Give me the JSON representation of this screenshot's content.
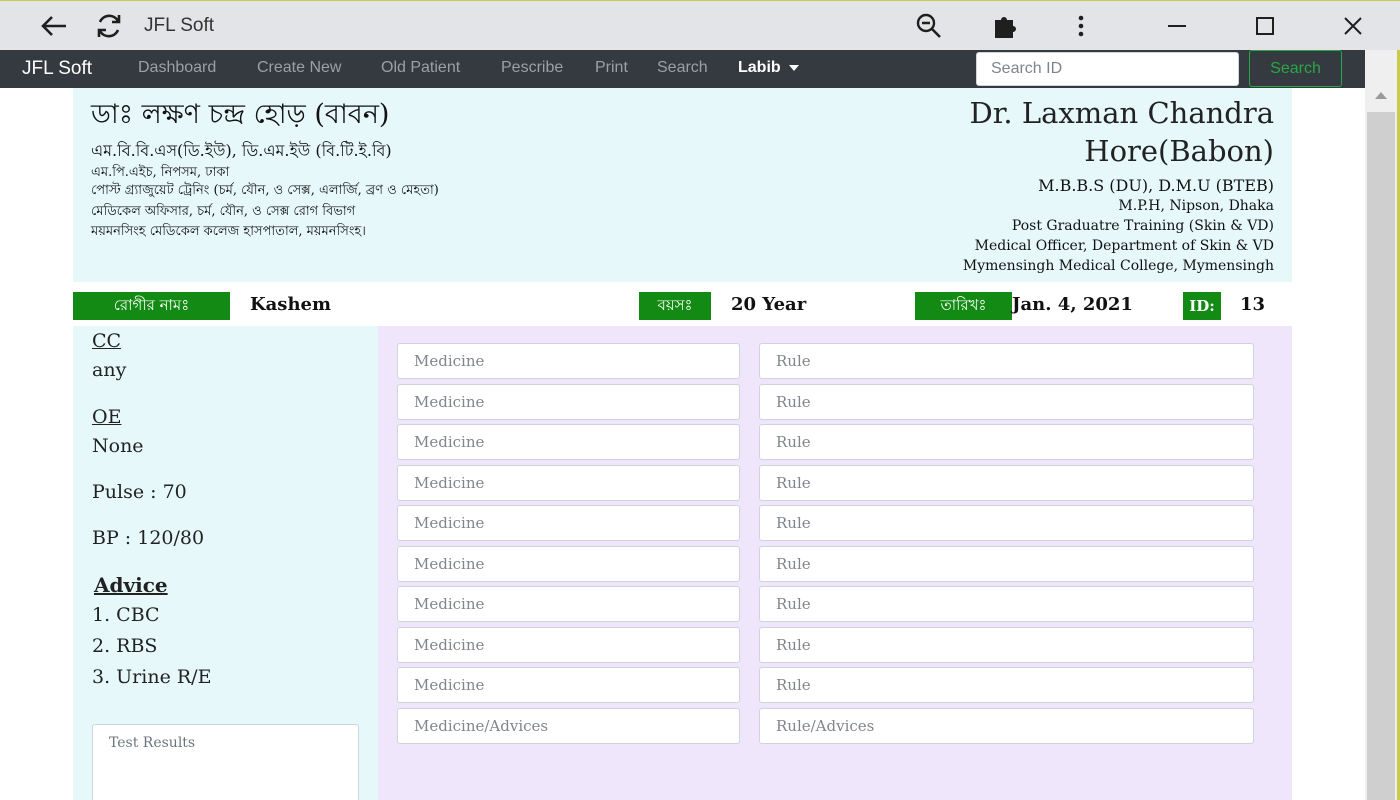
{
  "window": {
    "title": "JFL Soft",
    "icons": [
      "back-arrow-icon",
      "reload-icon",
      "zoom-out-icon",
      "extensions-icon",
      "more-vert-icon",
      "minimize-icon",
      "maximize-icon",
      "close-icon"
    ]
  },
  "navbar": {
    "brand": "JFL Soft",
    "links": [
      "Dashboard",
      "Create New",
      "Old Patient",
      "Pescribe",
      "Print",
      "Search"
    ],
    "user": "Labib",
    "search_placeholder": "Search ID",
    "search_button": "Search"
  },
  "doctor": {
    "bn_name": "ডাঃ লক্ষণ চন্দ্র হোড় (বাবন)",
    "bn_degrees": "এম.বি.বি.এস(ডি.ইউ), ডি.এম.ইউ (বি.টি.ই.বি)",
    "bn_lines": [
      "এম.পি.এইচ, নিপসম, ঢাকা",
      "পোস্ট গ্র্যাজুয়েট ট্রেনিং (চর্ম, যৌন, ও সেক্স, এলার্জি, ব্রণ ও মেহতা)",
      "মেডিকেল অফিসার, চর্ম, যৌন, ও সেক্স রোগ বিভাগ",
      "ময়মনসিংহ মেডিকেল কলেজ হাসপাতাল, ময়মনসিংহ।"
    ],
    "en_name": "Dr. Laxman Chandra Hore(Babon)",
    "en_degrees": "M.B.B.S (DU), D.M.U (BTEB)",
    "en_lines": [
      "M.P.H, Nipson, Dhaka",
      "Post Graduatre Training (Skin & VD)",
      "Medical Officer, Department of Skin & VD",
      "Mymensingh Medical College, Mymensingh"
    ]
  },
  "patient": {
    "name_label": "রোগীর নামঃ",
    "name": "Kashem",
    "age_label": "বয়সঃ",
    "age": "20 Year",
    "date_label": "তারিখঃ",
    "date": "Jan. 4, 2021",
    "id_label": "ID:",
    "id": "13"
  },
  "findings": {
    "cc_label": "CC",
    "cc_value": "any",
    "oe_label": "OE",
    "oe_value": "None",
    "pulse": "Pulse : 70",
    "bp": "BP : 120/80",
    "advice_label": "Advice",
    "advice_items": [
      "1. CBC",
      "2. RBS",
      "3. Urine R/E"
    ],
    "test_results_placeholder": "Test Results"
  },
  "prescription": {
    "rows": [
      {
        "medicine": "Medicine",
        "rule": "Rule"
      },
      {
        "medicine": "Medicine",
        "rule": "Rule"
      },
      {
        "medicine": "Medicine",
        "rule": "Rule"
      },
      {
        "medicine": "Medicine",
        "rule": "Rule"
      },
      {
        "medicine": "Medicine",
        "rule": "Rule"
      },
      {
        "medicine": "Medicine",
        "rule": "Rule"
      },
      {
        "medicine": "Medicine",
        "rule": "Rule"
      },
      {
        "medicine": "Medicine",
        "rule": "Rule"
      },
      {
        "medicine": "Medicine",
        "rule": "Rule"
      },
      {
        "medicine": "Medicine/Advices",
        "rule": "Rule/Advices"
      }
    ]
  },
  "colors": {
    "navbar_bg": "#343a40",
    "label_green": "#138a13",
    "header_bg": "#e6f8fa",
    "rx_panel_bg": "#efe6fb",
    "search_green": "#28a745"
  }
}
